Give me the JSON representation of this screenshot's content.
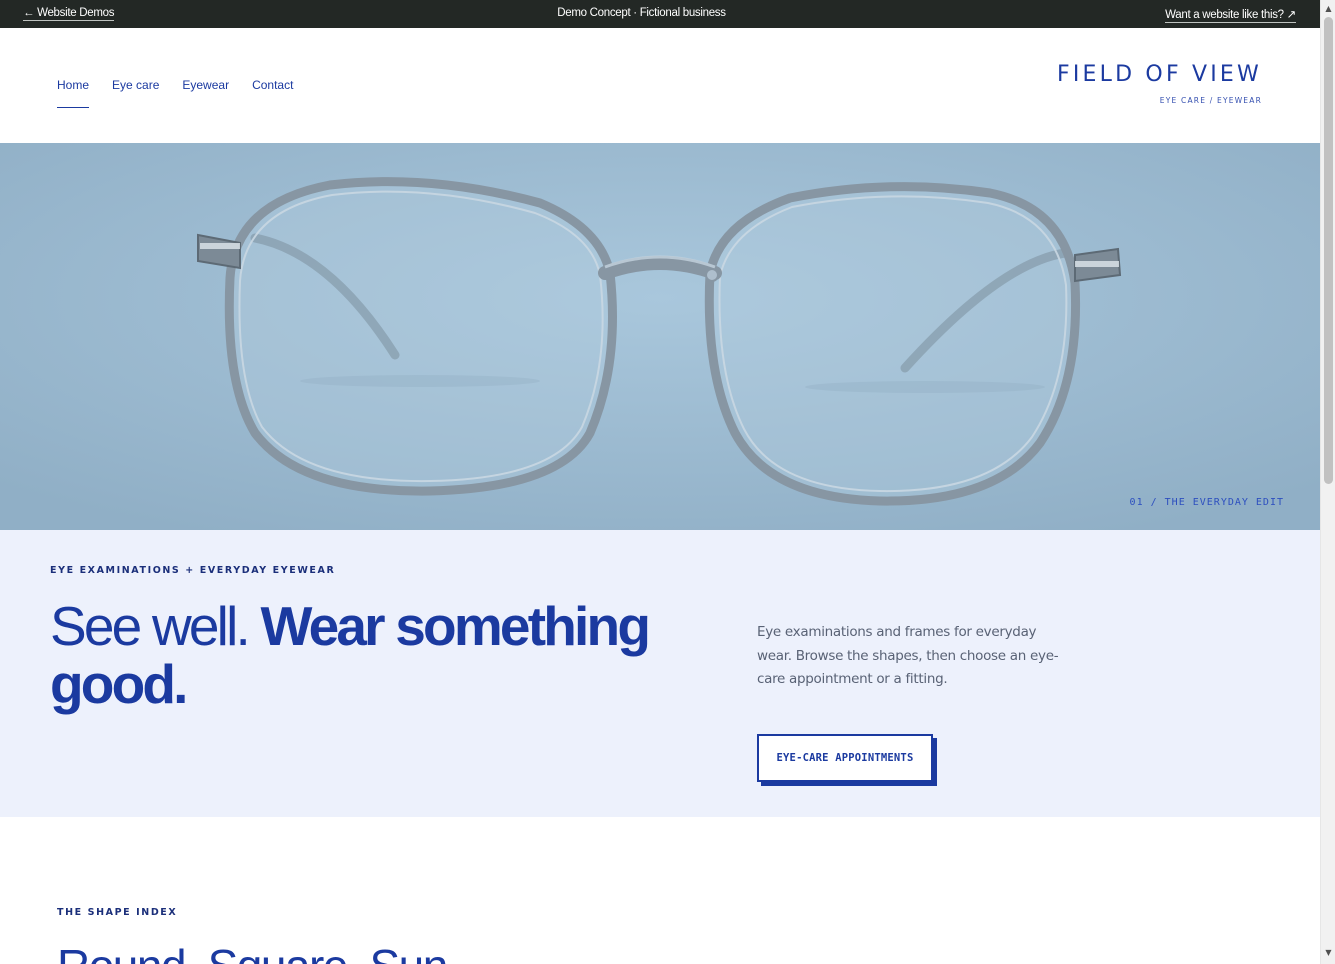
{
  "topbar": {
    "back_label": "← Website Demos",
    "center_label": "Demo Concept · Fictional business",
    "cta_label": "Want a website like this? ↗"
  },
  "nav": {
    "items": [
      {
        "label": "Home",
        "active": true
      },
      {
        "label": "Eye care"
      },
      {
        "label": "Eyewear"
      },
      {
        "label": "Contact"
      }
    ]
  },
  "brand": {
    "name": "FIELD OF VIEW",
    "tagline": "EYE CARE / EYEWEAR"
  },
  "hero": {
    "caption": "01 / THE EVERYDAY EDIT"
  },
  "intro": {
    "eyebrow": "EYE EXAMINATIONS + EVERYDAY EYEWEAR",
    "headline_light": "See well.",
    "headline_bold": "Wear something good.",
    "description": "Eye examinations and frames for everyday wear. Browse the shapes, then choose an eye-care appointment or a fitting.",
    "button_label": "EYE-CARE APPOINTMENTS"
  },
  "shape_index": {
    "eyebrow": "THE SHAPE INDEX",
    "heading": "Round. Square. Sun."
  },
  "colors": {
    "brand_blue": "#1b3aa0",
    "topbar_bg": "#232825",
    "intro_bg": "#edf1fc",
    "hero_bg": "#9dbcd3"
  },
  "icons": {
    "back": "arrow-left-icon",
    "external": "arrow-up-right-icon"
  }
}
